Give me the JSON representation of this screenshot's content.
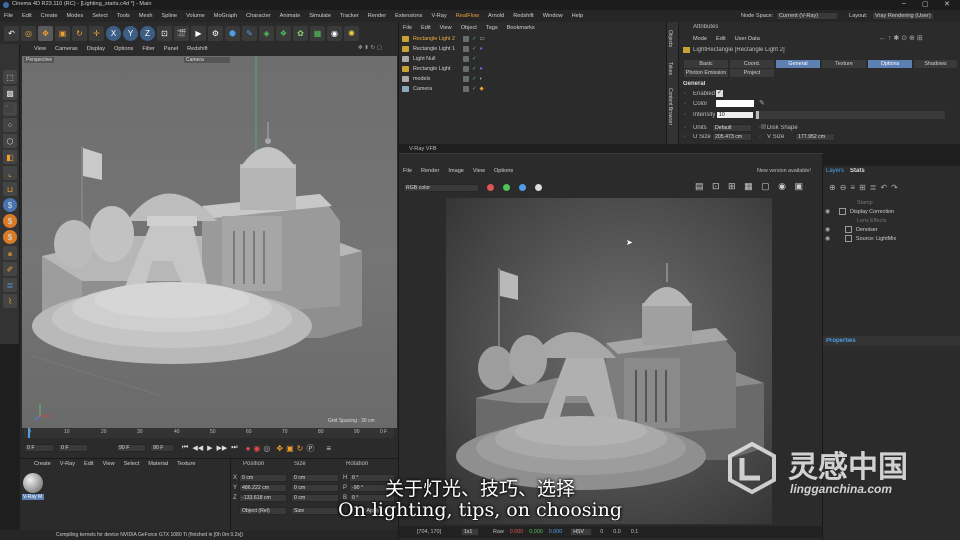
{
  "titlebar": {
    "title": "Cinema 4D R23.110 (RC) - [Lighting_starts.c4d *] - Main"
  },
  "menubar": {
    "items": [
      "File",
      "Edit",
      "Create",
      "Modes",
      "Select",
      "Tools",
      "Mesh",
      "Spline",
      "Volume",
      "MoGraph",
      "Character",
      "Animate",
      "Simulate",
      "Tracker",
      "Render",
      "Extensions",
      "V-Ray",
      "RealFlow",
      "Arnold",
      "Redshift",
      "Window",
      "Help"
    ],
    "node_space_label": "Node Space:",
    "node_space_value": "Current (V-Ray)",
    "layout_label": "Layout:",
    "layout_value": "Vray Rendering (User)"
  },
  "toolbar": {
    "xyz": [
      "X",
      "Y",
      "Z"
    ]
  },
  "viewport": {
    "menu": [
      "View",
      "Cameras",
      "Display",
      "Options",
      "Filter",
      "Panel",
      "Redshift"
    ],
    "name_left": "Perspective",
    "name_right": "Camera",
    "grid_spacing": "Grid Spacing : 30 cm"
  },
  "timeline": {
    "ticks": [
      "0",
      "10",
      "20",
      "30",
      "40",
      "50",
      "60",
      "70",
      "80",
      "90"
    ],
    "frame_current": "0 F",
    "frame_start": "0 F",
    "frame_end": "90 F",
    "frame_end2": "90 F",
    "frame_marker": "0 F"
  },
  "material_panel": {
    "menu": [
      "Create",
      "V-Ray",
      "Edit",
      "View",
      "Select",
      "Material",
      "Texture"
    ],
    "material_name": "V-Ray M"
  },
  "coords": {
    "headers": [
      "Position",
      "Size",
      "Rotation"
    ],
    "rows": [
      {
        "axis": "X",
        "pos": "0 cm",
        "size": "0 cm",
        "rot_axis": "H",
        "rot": "0 °"
      },
      {
        "axis": "Y",
        "pos": "486.222 cm",
        "size": "0 cm",
        "rot_axis": "P",
        "rot": "-90 °"
      },
      {
        "axis": "Z",
        "pos": "-133.618 cm",
        "size": "0 cm",
        "rot_axis": "B",
        "rot": "0 °"
      }
    ],
    "mode": "Object (Rel)",
    "size_mode": "Size",
    "apply": "Apply"
  },
  "status": {
    "text": "Compiling kernels for device NVIDIA GeForce GTX 1080 Ti (finished in [0h 0m 0.2s])"
  },
  "objects": {
    "menu": [
      "File",
      "Edit",
      "View",
      "Object",
      "Tags",
      "Bookmarks"
    ],
    "items": [
      "Rectangle Light 2",
      "Rectangle Light 1",
      "Light Null",
      "Rectangle Light",
      "models",
      "Camera"
    ],
    "side_tabs": [
      "Objects",
      "Takes",
      "Content Browser"
    ]
  },
  "attributes": {
    "title": "Attributes",
    "menu": [
      "Mode",
      "Edit",
      "User Data"
    ],
    "object": "LightRectangle [Rectangle Light 2]",
    "tabs_row1": [
      "Basic",
      "Coord.",
      "General",
      "Texture",
      "Options",
      "Shadows"
    ],
    "tabs_row2": [
      "Photon Emission",
      "Project"
    ],
    "section": "General",
    "enabled_label": "Enabled",
    "color_label": "Color",
    "intensity_label": "Intensity",
    "intensity_value": "10",
    "units_label": "Units",
    "units_value": "Default",
    "disk_shape_label": "Disk Shape",
    "u_size_label": "U Size",
    "u_size_value": "205.473 cm",
    "v_size_label": "V Size",
    "v_size_value": "177.952 cm"
  },
  "vfb": {
    "title": "V-Ray VFB",
    "menu": [
      "File",
      "Render",
      "Image",
      "View",
      "Options"
    ],
    "notice": "New version available!",
    "channel": "RGB color",
    "channel_dots": [
      "#e05555",
      "#4fc35a",
      "#4f9ee8",
      "#dddddd"
    ],
    "coords": "[704, 170]",
    "zoom": "1x1",
    "raw_label": "Raw",
    "raw_values": [
      "0.000",
      "0.000",
      "0.000"
    ],
    "colorspace": "HSV",
    "extra_values": [
      "0",
      "0.0",
      "0.1"
    ]
  },
  "layers_panel": {
    "tabs": [
      "Layers",
      "Stats"
    ],
    "items": [
      "Stamp",
      "Display Correction",
      "Lens Effects",
      "Denoiser",
      "Source: LightMix"
    ],
    "properties_title": "Properties"
  },
  "subtitle": {
    "chinese": "关于灯光、技巧、选择",
    "english": "On lighting, tips, on choosing"
  },
  "watermark": {
    "cn": "灵感中国",
    "url": "lingganchina.com"
  }
}
